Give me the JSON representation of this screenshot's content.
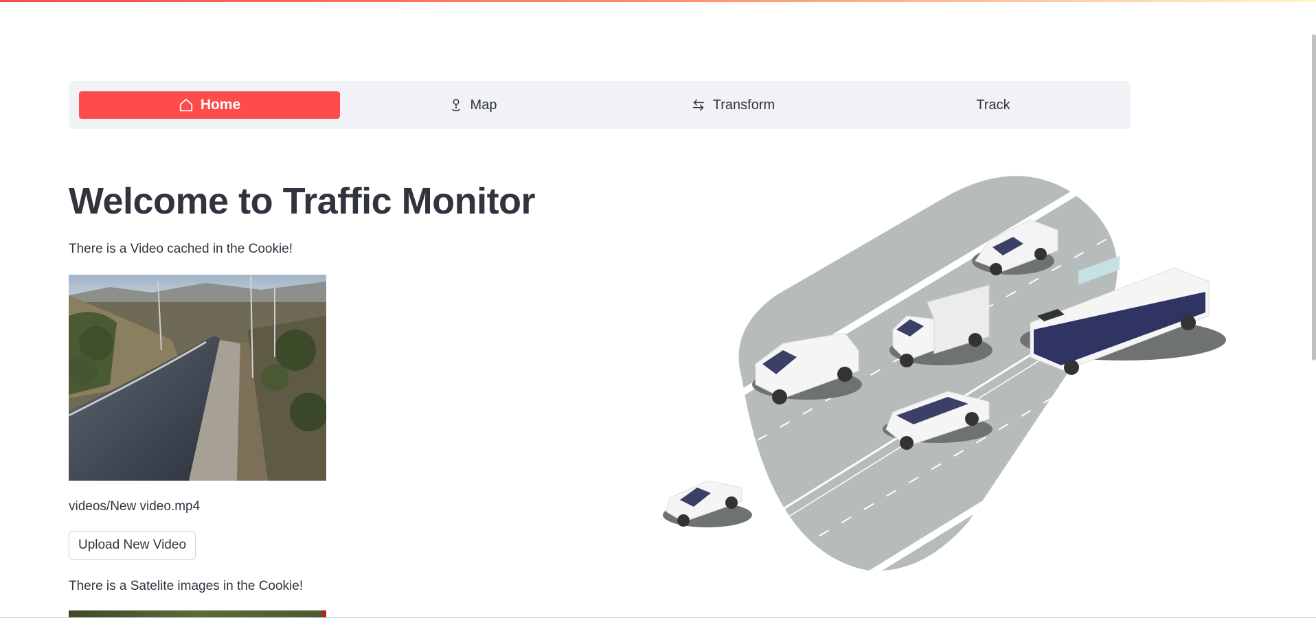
{
  "nav": {
    "items": [
      {
        "label": "Home",
        "icon": "house-icon",
        "active": true
      },
      {
        "label": "Map",
        "icon": "map-pin-icon",
        "active": false
      },
      {
        "label": "Transform",
        "icon": "arrows-swap-icon",
        "active": false
      },
      {
        "label": "Track",
        "icon": "",
        "active": false
      }
    ],
    "accent": "#ff4b4b",
    "background": "#f0f2f6"
  },
  "main": {
    "title": "Welcome to Traffic Monitor",
    "video_status": "There is a Video cached in the Cookie!",
    "video_path": "videos/New video.mp4",
    "upload_button": "Upload New Video",
    "satellite_status": "There is a Satelite images in the Cookie!"
  }
}
